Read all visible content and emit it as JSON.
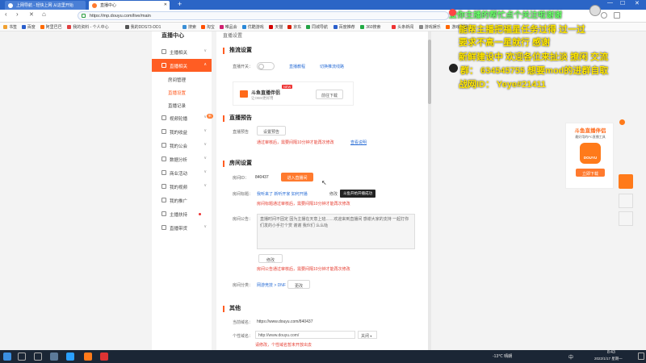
{
  "browser": {
    "tabs": [
      {
        "label": "上网导航 - 轻快上网 从这里开始"
      },
      {
        "label": "直播中心"
      }
    ],
    "new_tab": "+",
    "address": "https://mp.douyu.com/live/main",
    "nav": {
      "back": "‹",
      "forward": "›",
      "reload": "✕",
      "home": "⌂"
    },
    "window_controls": {
      "min": "—",
      "max": "☐",
      "close": "✕"
    },
    "bookmarks": [
      {
        "label": "书签",
        "color": "#f0a030"
      },
      {
        "label": "百度",
        "color": "#2a5fcc"
      },
      {
        "label": "阿里巴巴",
        "color": "#ff6a00"
      },
      {
        "label": "我的资料 - 个人中心",
        "color": "#e04040"
      },
      {
        "label": "我的DDS73-DD1",
        "color": "#555"
      },
      {
        "label": "搜索",
        "color": "#3a8fd6"
      },
      {
        "label": "淘宝",
        "color": "#ff5000"
      },
      {
        "label": "唯品会",
        "color": "#d02070"
      },
      {
        "label": "优酷游戏",
        "color": "#2a88d8"
      },
      {
        "label": "天猫",
        "color": "#d40000"
      },
      {
        "label": "京东",
        "color": "#d81e06"
      },
      {
        "label": "同城导航",
        "color": "#23a245"
      },
      {
        "label": "百度推荐",
        "color": "#2a5fcc"
      },
      {
        "label": "360搜索",
        "color": "#22aa44"
      },
      {
        "label": "头条新闻",
        "color": "#e33"
      },
      {
        "label": "游戏娱乐",
        "color": "#888"
      },
      {
        "label": "游戏直播",
        "color": "#f60"
      }
    ]
  },
  "sidebar": {
    "header": "直播中心",
    "items": [
      {
        "label": "主播相关",
        "arrow": "∨"
      },
      {
        "label": "直播相关",
        "arrow": "∧",
        "active": true
      },
      {
        "label": "房间管理",
        "sub": true
      },
      {
        "label": "直播设置",
        "sub": true,
        "selected": true
      },
      {
        "label": "直播记录",
        "sub": true
      },
      {
        "label": "视频轮播",
        "arrow": "∨",
        "badge": "新"
      },
      {
        "label": "我的收益",
        "arrow": "∨"
      },
      {
        "label": "我的公会",
        "arrow": "∨"
      },
      {
        "label": "数据分析",
        "arrow": "∨"
      },
      {
        "label": "商业活动",
        "arrow": "∨"
      },
      {
        "label": "我的视频",
        "arrow": "∨"
      },
      {
        "label": "我的推广",
        "arrow": ""
      },
      {
        "label": "主播扶持",
        "arrow": "",
        "dot": true
      },
      {
        "label": "直播带货",
        "arrow": "∨"
      }
    ]
  },
  "main": {
    "top_crumb": "直播设置",
    "push": {
      "title": "推流设置",
      "switch_label": "直播开关：",
      "link1": "直播教程",
      "link2": "切换推流线路",
      "companion_title": "斗鱼直播伴侣",
      "companion_new": "NEW",
      "companion_desc": "让OBS更好用",
      "companion_btn": "前往下载"
    },
    "preview": {
      "title": "直播预告",
      "label": "直播预告",
      "btn": "设置预告",
      "warn": "通过审核后，需要间隔10分钟才能再次修改",
      "link": "查看说明"
    },
    "room": {
      "title": "房间设置",
      "id_label": "房间ID：",
      "id_value": "840437",
      "enter_btn": "进入直播间",
      "title_label": "房间标题：",
      "title_value": "我听来了 新听开家 如何开播",
      "edit": "修改",
      "title_warn": "房间标题通过审核后，需要间隔10分钟才能再次修改",
      "tooltip": "斗鱼开始开播成功",
      "notice_label": "房间公告：",
      "notice_text": "直播时间不固定 因为主播在天意上班……欢迎来到直播间 感谢大家的支持 一起打你们发的小手打个赏 谢谢 我伙们 么么哒",
      "notice_btn": "修改",
      "notice_warn": "房间公告通过审核后，需要间隔10分钟才能再次修改",
      "cat_label": "房间分类：",
      "cat_value": "网游竞技 > DNF",
      "cat_btn": "更改"
    },
    "other": {
      "title": "其他",
      "domain_label": "当前域名：",
      "domain_value": "https://www.douyu.com/840437",
      "custom_label": "个性域名：",
      "custom_value": "http://www.douyu.com/",
      "custom_select": "关闭",
      "custom_warn": "请修改，个性域名暂未开放出去"
    }
  },
  "overlay": {
    "l1": "爱你主播的帮忙点个关注啦谢谢",
    "l2": "能帮主播把福星任务过得 过一过",
    "l3": "要求不高一星就行 感谢",
    "l4": "新鲜建设中 欢迎各位来扯淡 撩闲 交流",
    "l5": "群：  634545755  想要mod的进群自取",
    "l6": "战网ID：  Yeye#21411"
  },
  "ad": {
    "title": "斗鱼直播伴侣",
    "desc": "最好用的PC直播工具",
    "logo": "DOUYU",
    "btn": "立即下载"
  },
  "taskbar": {
    "weather": "-13℃ 晴朗",
    "time": "8:43",
    "date": "2022/1/17 星期一",
    "ime": "中"
  }
}
